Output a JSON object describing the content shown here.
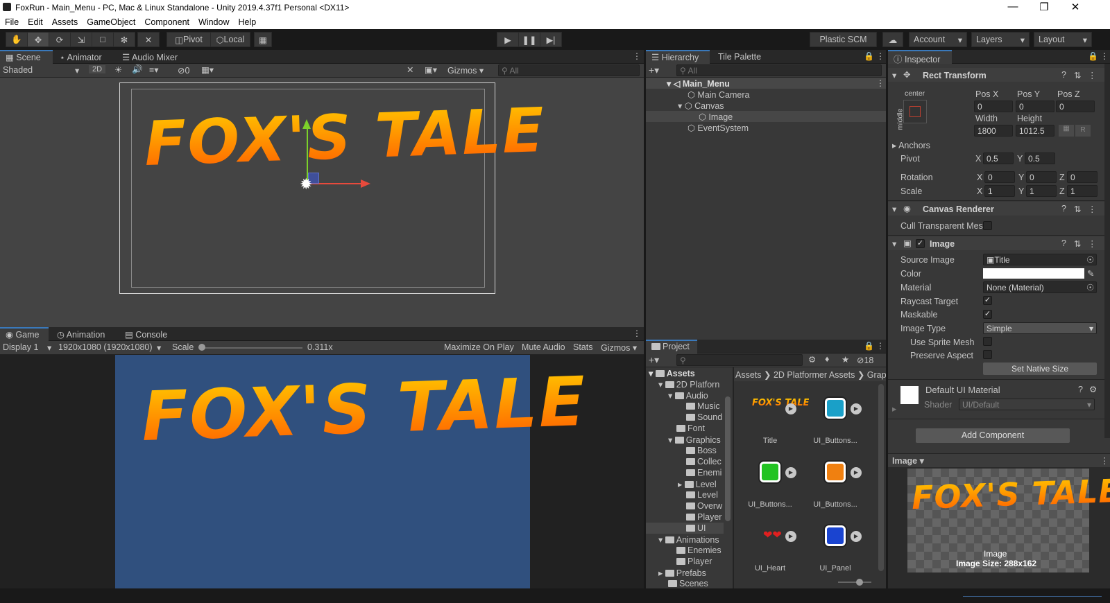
{
  "window": {
    "title": "FoxRun - Main_Menu - PC, Mac & Linux Standalone - Unity 2019.4.37f1 Personal <DX11>"
  },
  "menu": [
    "File",
    "Edit",
    "Assets",
    "GameObject",
    "Component",
    "Window",
    "Help"
  ],
  "toolbar": {
    "pivot": "Pivot",
    "local": "Local",
    "plastic": "Plastic SCM",
    "account": "Account",
    "layers": "Layers",
    "layout": "Layout"
  },
  "scene": {
    "tabs": [
      "Scene",
      "Animator",
      "Audio Mixer"
    ],
    "shading": "Shaded",
    "mode2d": "2D",
    "hidden_count": "0",
    "gizmos": "Gizmos",
    "search_placeholder": "All",
    "logo_text": "FOX'S TALE"
  },
  "game": {
    "tabs": [
      "Game",
      "Animation",
      "Console"
    ],
    "display": "Display 1",
    "resolution": "1920x1080 (1920x1080)",
    "scale_label": "Scale",
    "scale_value": "0.311x",
    "maximize": "Maximize On Play",
    "mute": "Mute Audio",
    "stats": "Stats",
    "gizmos": "Gizmos",
    "logo_text": "FOX'S TALE"
  },
  "hierarchy": {
    "tabs": [
      "Hierarchy",
      "Tile Palette"
    ],
    "search_placeholder": "All",
    "items": [
      {
        "label": "Main_Menu"
      },
      {
        "label": "Main Camera"
      },
      {
        "label": "Canvas"
      },
      {
        "label": "Image"
      },
      {
        "label": "EventSystem"
      }
    ]
  },
  "project": {
    "tab": "Project",
    "hidden_count": "18",
    "breadcrumb": [
      "Assets",
      "2D Platformer Assets",
      "Grap"
    ],
    "tree": [
      "Assets",
      "2D Platforn",
      "Audio",
      "Music",
      "Sound",
      "Font",
      "Graphics",
      "Boss",
      "Collec",
      "Enemi",
      "Level",
      "Level",
      "Overw",
      "Player",
      "UI",
      "Animations",
      "Enemies",
      "Player",
      "Prefabs",
      "Scenes"
    ],
    "assets": [
      {
        "name": "Title",
        "kind": "logo",
        "color": ""
      },
      {
        "name": "UI_Buttons...",
        "kind": "swatch",
        "color": "#1aa0c8"
      },
      {
        "name": "UI_Buttons...",
        "kind": "swatch",
        "color": "#22c322"
      },
      {
        "name": "UI_Buttons...",
        "kind": "swatch",
        "color": "#f08010"
      },
      {
        "name": "UI_Heart",
        "kind": "heart",
        "color": "#e02020"
      },
      {
        "name": "UI_Panel",
        "kind": "swatch",
        "color": "#1a44d0"
      }
    ]
  },
  "inspector": {
    "tab": "Inspector",
    "rect_transform": {
      "title": "Rect Transform",
      "anchor_h": "center",
      "anchor_v": "middle",
      "pos_x_label": "Pos X",
      "pos_y_label": "Pos Y",
      "pos_z_label": "Pos Z",
      "pos_x": "0",
      "pos_y": "0",
      "pos_z": "0",
      "width_label": "Width",
      "height_label": "Height",
      "width": "1800",
      "height": "1012.5",
      "anchors": "Anchors",
      "pivot": "Pivot",
      "pivot_x": "0.5",
      "pivot_y": "0.5",
      "rotation": "Rotation",
      "rot_x": "0",
      "rot_y": "0",
      "rot_z": "0",
      "scale": "Scale",
      "scale_x": "1",
      "scale_y": "1",
      "scale_z": "1",
      "r_button": "R"
    },
    "canvas_renderer": {
      "title": "Canvas Renderer",
      "cull": "Cull Transparent Mes"
    },
    "image": {
      "title": "Image",
      "source_label": "Source Image",
      "source": "Title",
      "color_label": "Color",
      "material_label": "Material",
      "material": "None (Material)",
      "raycast": "Raycast Target",
      "maskable": "Maskable",
      "type_label": "Image Type",
      "type": "Simple",
      "sprite_mesh": "Use Sprite Mesh",
      "preserve": "Preserve Aspect",
      "native_size": "Set Native Size"
    },
    "material": {
      "name": "Default UI Material",
      "shader_label": "Shader",
      "shader": "UI/Default"
    },
    "add_component": "Add Component",
    "preview": {
      "dropdown": "Image",
      "caption": "Image",
      "size": "Image Size: 288x162",
      "logo_text": "FOX'S TALE"
    }
  }
}
